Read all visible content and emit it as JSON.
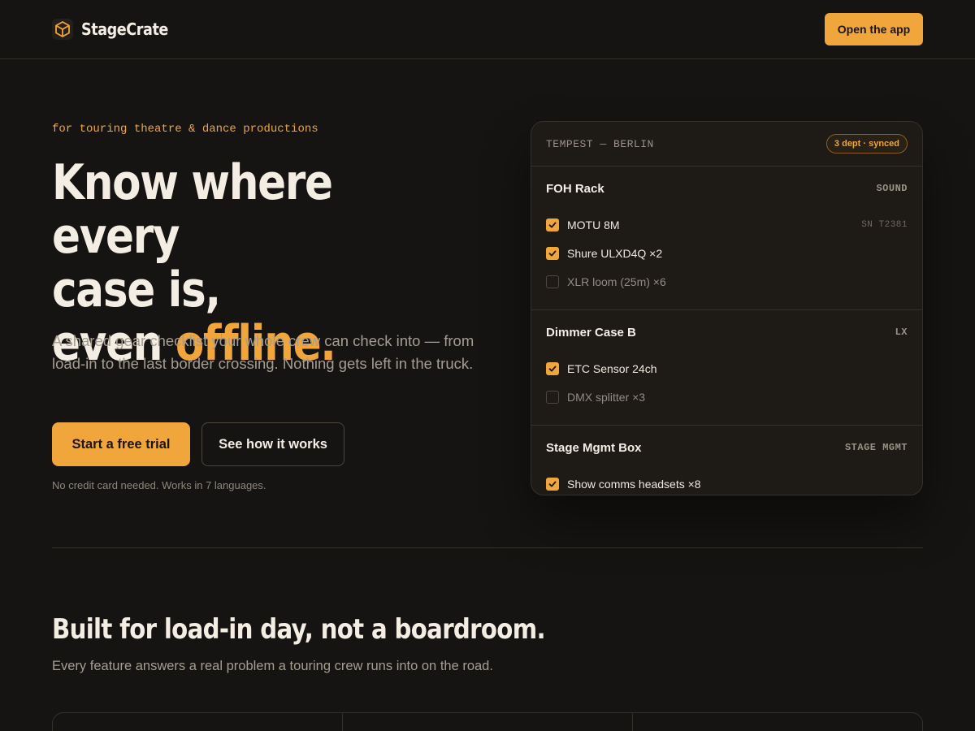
{
  "nav": {
    "brand": "StageCrate",
    "brand_icon": "box-icon",
    "cta_label": "Open the app"
  },
  "hero": {
    "eyebrow": "for touring theatre & dance productions",
    "title_line1": "Know where every",
    "title_line2": "case is,",
    "title_line3_prefix": "even ",
    "title_line3_accent": "offline.",
    "description": "A shared gear checklist your whole crew can check into — from load-in to the last border crossing. Nothing gets left in the truck.",
    "primary_label": "Start a free trial",
    "secondary_label": "See how it works",
    "note": "No credit card needed. Works in 7 languages."
  },
  "checklist": {
    "title": "TEMPEST — BERLIN",
    "badge": "3 dept · synced",
    "sections": [
      {
        "name": "FOH Rack",
        "dept": "SOUND",
        "items": [
          {
            "label": "MOTU 8M",
            "checked": true,
            "meta": "SN T2381"
          },
          {
            "label": "Shure ULXD4Q ×2",
            "checked": true,
            "meta": ""
          },
          {
            "label": "XLR loom (25m) ×6",
            "checked": false,
            "meta": ""
          }
        ]
      },
      {
        "name": "Dimmer Case B",
        "dept": "LX",
        "items": [
          {
            "label": "ETC Sensor 24ch",
            "checked": true,
            "meta": ""
          },
          {
            "label": "DMX splitter ×3",
            "checked": false,
            "meta": ""
          }
        ]
      },
      {
        "name": "Stage Mgmt Box",
        "dept": "STAGE MGMT",
        "items": [
          {
            "label": "Show comms headsets ×8",
            "checked": true,
            "meta": ""
          }
        ]
      }
    ]
  },
  "features": {
    "title": "Built for load-in day, not a boardroom.",
    "subtitle": "Every feature answers a real problem a touring crew runs into on the road."
  },
  "colors": {
    "background": "#161412",
    "accent": "#f0a63a",
    "card": "#1e1b17",
    "border": "#35302a"
  }
}
